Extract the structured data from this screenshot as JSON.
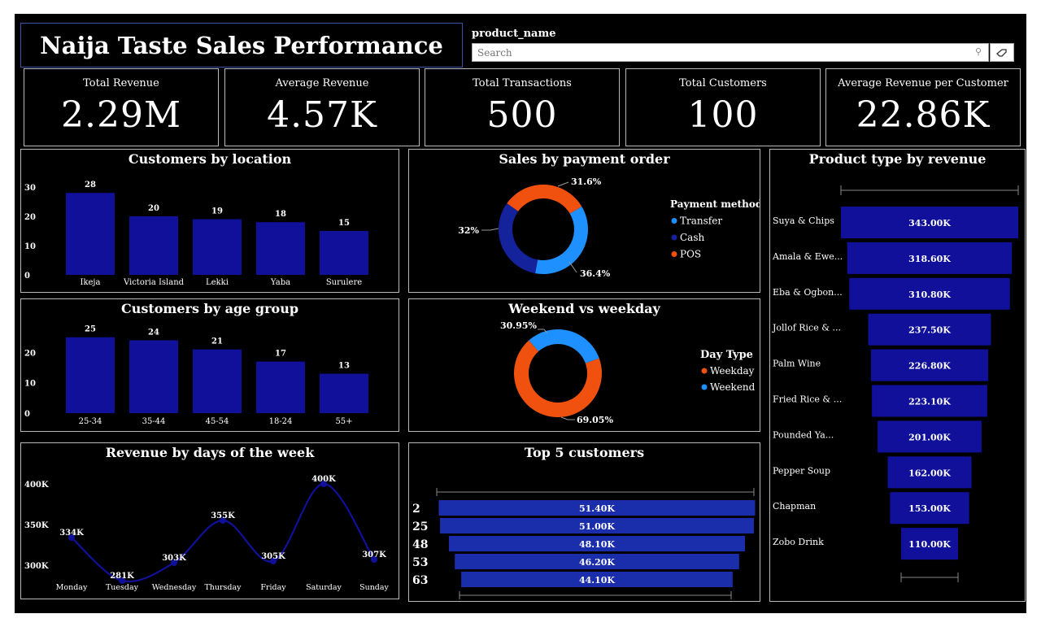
{
  "header": {
    "title": "Naija Taste Sales Performance"
  },
  "slicer": {
    "label": "product_name",
    "placeholder": "Search"
  },
  "kpis": [
    {
      "label": "Total Revenue",
      "value": "2.29M"
    },
    {
      "label": "Average Revenue",
      "value": "4.57K"
    },
    {
      "label": "Total Transactions",
      "value": "500"
    },
    {
      "label": "Total Customers",
      "value": "100"
    },
    {
      "label": "Average Revenue per Customer",
      "value": "22.86K"
    }
  ],
  "colors": {
    "bar_dark": "#10109a",
    "bar_blue": "#1a2dab",
    "transfer": "#1e90ff",
    "cash": "#14229b",
    "pos": "#f0510f",
    "weekday": "#f0510f",
    "weekend": "#1e90ff"
  },
  "chart_data": [
    {
      "id": "location",
      "type": "bar",
      "title": "Customers by location",
      "categories": [
        "Ikeja",
        "Victoria Island",
        "Lekki",
        "Yaba",
        "Surulere"
      ],
      "values": [
        28,
        20,
        19,
        18,
        15
      ],
      "ylim": [
        0,
        30
      ],
      "yticks": [
        "0",
        "10",
        "20",
        "30"
      ]
    },
    {
      "id": "age",
      "type": "bar",
      "title": "Customers by age group",
      "categories": [
        "25-34",
        "35-44",
        "45-54",
        "18-24",
        "55+"
      ],
      "values": [
        25,
        24,
        21,
        17,
        13
      ],
      "ylim": [
        0,
        26
      ],
      "yticks": [
        "0",
        "10",
        "20"
      ]
    },
    {
      "id": "days",
      "type": "line",
      "title": "Revenue by days of the week",
      "categories": [
        "Monday",
        "Tuesday",
        "Wednesday",
        "Thursday",
        "Friday",
        "Saturday",
        "Sunday"
      ],
      "values": [
        334,
        281,
        303,
        355,
        305,
        400,
        307
      ],
      "labels": [
        "334K",
        "281K",
        "303K",
        "355K",
        "305K",
        "400K",
        "307K"
      ],
      "yticks": [
        {
          "v": 300,
          "t": "300K"
        },
        {
          "v": 350,
          "t": "350K"
        },
        {
          "v": 400,
          "t": "400K"
        }
      ]
    },
    {
      "id": "payment",
      "type": "pie",
      "title": "Sales by payment order",
      "legend_title": "Payment method",
      "slices": [
        {
          "name": "Transfer",
          "value": 36.4,
          "label": "36.4%"
        },
        {
          "name": "Cash",
          "value": 32.0,
          "label": "32%"
        },
        {
          "name": "POS",
          "value": 31.6,
          "label": "31.6%"
        }
      ]
    },
    {
      "id": "daytype",
      "type": "pie",
      "title": "Weekend vs weekday",
      "legend_title": "Day Type",
      "slices": [
        {
          "name": "Weekday",
          "value": 69.05,
          "label": "69.05%"
        },
        {
          "name": "Weekend",
          "value": 30.95,
          "label": "30.95%"
        }
      ]
    },
    {
      "id": "top5",
      "type": "bar",
      "title": "Top 5 customers",
      "categories": [
        "2",
        "25",
        "48",
        "53",
        "63"
      ],
      "values": [
        51.4,
        51.0,
        48.1,
        46.2,
        44.1
      ],
      "labels": [
        "51.40K",
        "51.00K",
        "48.10K",
        "46.20K",
        "44.10K"
      ]
    },
    {
      "id": "products",
      "type": "bar",
      "title": "Product type by revenue",
      "categories": [
        "Suya & Chips",
        "Amala & Ewe...",
        "Eba & Ogbon...",
        "Jollof Rice & ...",
        "Palm Wine",
        "Fried Rice & ...",
        "Pounded Ya...",
        "Pepper Soup",
        "Chapman",
        "Zobo Drink"
      ],
      "values": [
        343.0,
        318.6,
        310.8,
        237.5,
        226.8,
        223.1,
        201.0,
        162.0,
        153.0,
        110.0
      ],
      "labels": [
        "343.00K",
        "318.60K",
        "310.80K",
        "237.50K",
        "226.80K",
        "223.10K",
        "201.00K",
        "162.00K",
        "153.00K",
        "110.00K"
      ]
    }
  ]
}
